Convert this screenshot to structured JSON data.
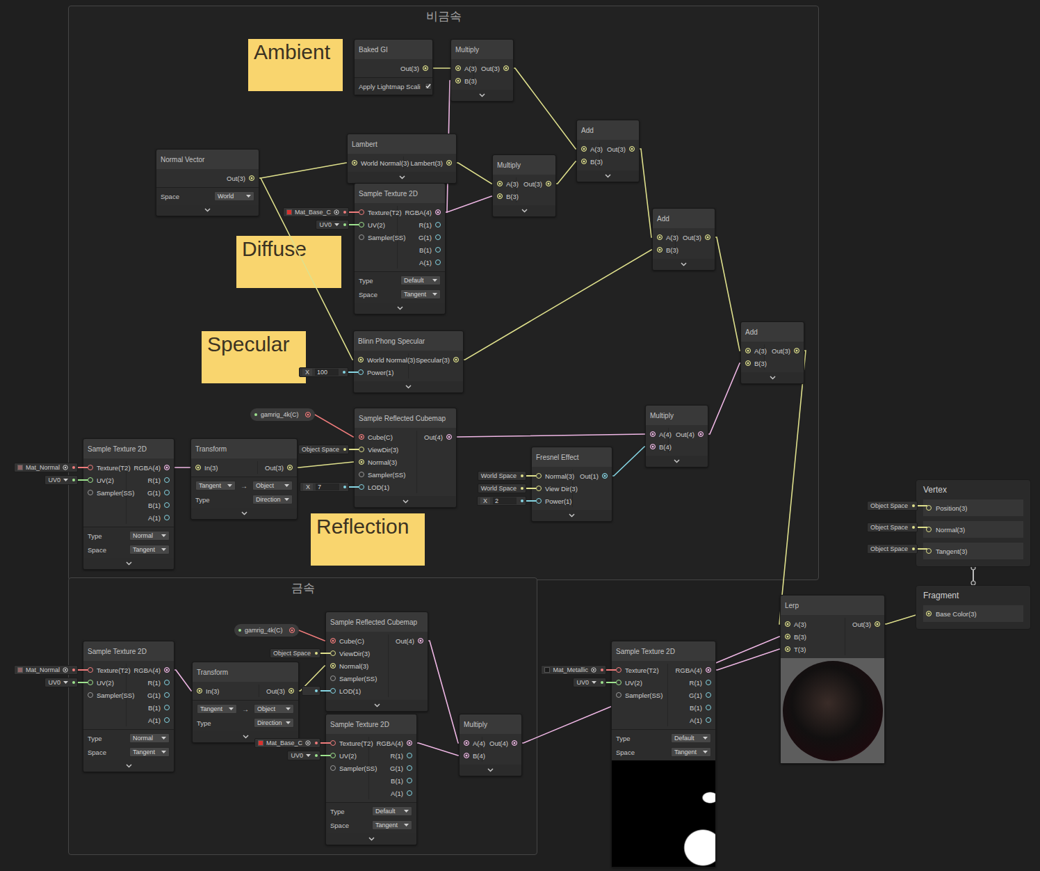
{
  "groups": [
    {
      "title": "비금속"
    },
    {
      "title": "금속"
    }
  ],
  "notes": [
    {
      "text": "Ambient"
    },
    {
      "text": "Diffuse"
    },
    {
      "text": "Specular"
    },
    {
      "text": "Reflection"
    }
  ],
  "pills": [
    {
      "text": "gamrig_4k(C)"
    },
    {
      "text": "gamrig_4k(C)"
    }
  ],
  "nodes": [
    {
      "title": "Baked GI",
      "inputs": [],
      "outputs": [
        {
          "label": "Out(3)",
          "connected": true
        }
      ],
      "props": [
        {
          "kind": "checkbox",
          "label": "Apply Lightmap Scali",
          "checked": true
        }
      ],
      "chevron": false
    },
    {
      "title": "Multiply",
      "inputs": [
        {
          "label": "A(3)",
          "connected": true
        },
        {
          "label": "B(3)",
          "connected": true
        }
      ],
      "outputs": [
        {
          "label": "Out(3)",
          "connected": true
        }
      ],
      "props": [],
      "chevron": true
    },
    {
      "title": "Add",
      "inputs": [
        {
          "label": "A(3)",
          "connected": true
        },
        {
          "label": "B(3)",
          "connected": true
        }
      ],
      "outputs": [
        {
          "label": "Out(3)",
          "connected": true
        }
      ],
      "props": [],
      "chevron": true
    },
    {
      "title": "Normal Vector",
      "inputs": [],
      "outputs": [
        {
          "label": "Out(3)",
          "connected": true
        }
      ],
      "props": [
        {
          "kind": "dropdown",
          "label": "Space",
          "value": "World"
        }
      ],
      "chevron": true
    },
    {
      "title": "Lambert",
      "inputs": [
        {
          "label": "World Normal(3)",
          "connected": true
        }
      ],
      "outputs": [
        {
          "label": "Lambert(3)",
          "connected": true
        }
      ],
      "props": [],
      "chevron": true
    },
    {
      "title": "Multiply",
      "inputs": [
        {
          "label": "A(3)",
          "connected": true
        },
        {
          "label": "B(3)",
          "connected": true
        }
      ],
      "outputs": [
        {
          "label": "Out(3)",
          "connected": true
        }
      ],
      "props": [],
      "chevron": true
    },
    {
      "title": "Sample Texture 2D",
      "inputs": [
        {
          "label": "Texture(T2)",
          "connected": false,
          "field": {
            "kind": "texture",
            "text": "Mat_Base_C",
            "color": "#d8322e"
          }
        },
        {
          "label": "UV(2)",
          "connected": false,
          "field": {
            "kind": "dropdown",
            "text": "UV0"
          }
        },
        {
          "label": "Sampler(SS)",
          "connected": false
        }
      ],
      "outputs": [
        {
          "label": "RGBA(4)",
          "connected": true
        },
        {
          "label": "R(1)",
          "connected": false
        },
        {
          "label": "G(1)",
          "connected": false
        },
        {
          "label": "B(1)",
          "connected": false
        },
        {
          "label": "A(1)",
          "connected": false
        }
      ],
      "props": [
        {
          "kind": "dropdown",
          "label": "Type",
          "value": "Default"
        },
        {
          "kind": "dropdown",
          "label": "Space",
          "value": "Tangent"
        }
      ],
      "chevron": true
    },
    {
      "title": "Add",
      "inputs": [
        {
          "label": "A(3)",
          "connected": true
        },
        {
          "label": "B(3)",
          "connected": true
        }
      ],
      "outputs": [
        {
          "label": "Out(3)",
          "connected": true
        }
      ],
      "props": [],
      "chevron": true
    },
    {
      "title": "Add",
      "inputs": [
        {
          "label": "A(3)",
          "connected": true
        },
        {
          "label": "B(3)",
          "connected": true
        }
      ],
      "outputs": [
        {
          "label": "Out(3)",
          "connected": true
        }
      ],
      "props": [],
      "chevron": true
    },
    {
      "title": "Blinn Phong Specular",
      "inputs": [
        {
          "label": "World Normal(3)",
          "connected": true
        },
        {
          "label": "Power(1)",
          "connected": false,
          "field": {
            "kind": "number",
            "label": "X",
            "text": "100"
          }
        }
      ],
      "outputs": [
        {
          "label": "Specular(3)",
          "connected": true
        }
      ],
      "props": [],
      "chevron": true
    },
    {
      "title": "Sample Reflected Cubemap",
      "inputs": [
        {
          "label": "Cube(C)",
          "connected": true
        },
        {
          "label": "ViewDir(3)",
          "connected": false,
          "field": {
            "kind": "text",
            "text": "Object Space"
          }
        },
        {
          "label": "Normal(3)",
          "connected": true
        },
        {
          "label": "Sampler(SS)",
          "connected": false
        },
        {
          "label": "LOD(1)",
          "connected": false,
          "field": {
            "kind": "number",
            "label": "X",
            "text": "7"
          }
        }
      ],
      "outputs": [
        {
          "label": "Out(4)",
          "connected": true
        }
      ],
      "props": [],
      "chevron": true
    },
    {
      "title": "Multiply",
      "inputs": [
        {
          "label": "A(4)",
          "connected": true
        },
        {
          "label": "B(4)",
          "connected": true
        }
      ],
      "outputs": [
        {
          "label": "Out(4)",
          "connected": true
        }
      ],
      "props": [],
      "chevron": true
    },
    {
      "title": "Fresnel Effect",
      "inputs": [
        {
          "label": "Normal(3)",
          "connected": false,
          "field": {
            "kind": "text",
            "text": "World Space"
          }
        },
        {
          "label": "View Dir(3)",
          "connected": false,
          "field": {
            "kind": "text",
            "text": "World Space"
          }
        },
        {
          "label": "Power(1)",
          "connected": false,
          "field": {
            "kind": "number",
            "label": "X",
            "text": "2"
          }
        }
      ],
      "outputs": [
        {
          "label": "Out(1)",
          "connected": true
        }
      ],
      "props": [],
      "chevron": true
    },
    {
      "title": "Sample Texture 2D",
      "inputs": [
        {
          "label": "Texture(T2)",
          "connected": false,
          "field": {
            "kind": "texture",
            "text": "Mat_Normal",
            "color": "#8c6464"
          }
        },
        {
          "label": "UV(2)",
          "connected": false,
          "field": {
            "kind": "dropdown",
            "text": "UV0"
          }
        },
        {
          "label": "Sampler(SS)",
          "connected": false
        }
      ],
      "outputs": [
        {
          "label": "RGBA(4)",
          "connected": true
        },
        {
          "label": "R(1)",
          "connected": false
        },
        {
          "label": "G(1)",
          "connected": false
        },
        {
          "label": "B(1)",
          "connected": false
        },
        {
          "label": "A(1)",
          "connected": false
        }
      ],
      "props": [
        {
          "kind": "dropdown",
          "label": "Type",
          "value": "Normal"
        },
        {
          "kind": "dropdown",
          "label": "Space",
          "value": "Tangent"
        }
      ],
      "chevron": true
    },
    {
      "title": "Transform",
      "inputs": [
        {
          "label": "In(3)",
          "connected": true
        }
      ],
      "outputs": [
        {
          "label": "Out(3)",
          "connected": true
        }
      ],
      "props": [
        {
          "kind": "transform",
          "from": "Tangent",
          "arrow": "→",
          "to": "Object"
        },
        {
          "kind": "dropdown",
          "label": "Type",
          "value": "Direction"
        }
      ],
      "chevron": true
    },
    {
      "title": "Lerp",
      "inputs": [
        {
          "label": "A(3)",
          "connected": true
        },
        {
          "label": "B(3)",
          "connected": true
        },
        {
          "label": "T(3)",
          "connected": true
        }
      ],
      "outputs": [
        {
          "label": "Out(3)",
          "connected": true
        }
      ],
      "props": [],
      "preview": "sphere",
      "chevron": false
    },
    {
      "title": "Sample Texture 2D",
      "inputs": [
        {
          "label": "Texture(T2)",
          "connected": false,
          "field": {
            "kind": "texture",
            "text": "Mat_Normal",
            "color": "#8c6464"
          }
        },
        {
          "label": "UV(2)",
          "connected": false,
          "field": {
            "kind": "dropdown",
            "text": "UV0"
          }
        },
        {
          "label": "Sampler(SS)",
          "connected": false
        }
      ],
      "outputs": [
        {
          "label": "RGBA(4)",
          "connected": true
        },
        {
          "label": "R(1)",
          "connected": false
        },
        {
          "label": "G(1)",
          "connected": false
        },
        {
          "label": "B(1)",
          "connected": false
        },
        {
          "label": "A(1)",
          "connected": false
        }
      ],
      "props": [
        {
          "kind": "dropdown",
          "label": "Type",
          "value": "Normal"
        },
        {
          "kind": "dropdown",
          "label": "Space",
          "value": "Tangent"
        }
      ],
      "chevron": true
    },
    {
      "title": "Transform",
      "inputs": [
        {
          "label": "In(3)",
          "connected": true
        }
      ],
      "outputs": [
        {
          "label": "Out(3)",
          "connected": true
        }
      ],
      "props": [
        {
          "kind": "transform",
          "from": "Tangent",
          "arrow": "→",
          "to": "Object"
        },
        {
          "kind": "dropdown",
          "label": "Type",
          "value": "Direction"
        }
      ],
      "chevron": true
    },
    {
      "title": "Sample Reflected Cubemap",
      "inputs": [
        {
          "label": "Cube(C)",
          "connected": true
        },
        {
          "label": "ViewDir(3)",
          "connected": false,
          "field": {
            "kind": "text",
            "text": "Object Space"
          }
        },
        {
          "label": "Normal(3)",
          "connected": true
        },
        {
          "label": "Sampler(SS)",
          "connected": false
        },
        {
          "label": "LOD(1)",
          "connected": false,
          "field": {
            "kind": "blank"
          }
        }
      ],
      "outputs": [
        {
          "label": "Out(4)",
          "connected": true
        }
      ],
      "props": [],
      "chevron": true
    },
    {
      "title": "Sample Texture 2D",
      "inputs": [
        {
          "label": "Texture(T2)",
          "connected": false,
          "field": {
            "kind": "texture",
            "text": "Mat_Base_C",
            "color": "#d8322e"
          }
        },
        {
          "label": "UV(2)",
          "connected": false,
          "field": {
            "kind": "dropdown",
            "text": "UV0"
          }
        },
        {
          "label": "Sampler(SS)",
          "connected": false
        }
      ],
      "outputs": [
        {
          "label": "RGBA(4)",
          "connected": true
        },
        {
          "label": "R(1)",
          "connected": false
        },
        {
          "label": "G(1)",
          "connected": false
        },
        {
          "label": "B(1)",
          "connected": false
        },
        {
          "label": "A(1)",
          "connected": false
        }
      ],
      "props": [
        {
          "kind": "dropdown",
          "label": "Type",
          "value": "Default"
        },
        {
          "kind": "dropdown",
          "label": "Space",
          "value": "Tangent"
        }
      ],
      "chevron": true
    },
    {
      "title": "Multiply",
      "inputs": [
        {
          "label": "A(4)",
          "connected": true
        },
        {
          "label": "B(4)",
          "connected": true
        }
      ],
      "outputs": [
        {
          "label": "Out(4)",
          "connected": true
        }
      ],
      "props": [],
      "chevron": true
    },
    {
      "title": "Sample Texture 2D",
      "inputs": [
        {
          "label": "Texture(T2)",
          "connected": false,
          "field": {
            "kind": "texture",
            "text": "Mat_Metallic",
            "color": "#1a1a1a"
          }
        },
        {
          "label": "UV(2)",
          "connected": false,
          "field": {
            "kind": "dropdown",
            "text": "UV0"
          }
        },
        {
          "label": "Sampler(SS)",
          "connected": false
        }
      ],
      "outputs": [
        {
          "label": "RGBA(4)",
          "connected": true
        },
        {
          "label": "R(1)",
          "connected": false
        },
        {
          "label": "G(1)",
          "connected": false
        },
        {
          "label": "B(1)",
          "connected": false
        },
        {
          "label": "A(1)",
          "connected": false
        }
      ],
      "props": [
        {
          "kind": "dropdown",
          "label": "Type",
          "value": "Default"
        },
        {
          "kind": "dropdown",
          "label": "Space",
          "value": "Tangent"
        }
      ],
      "preview": "mask",
      "chevron": false
    }
  ],
  "master": {
    "vertex": {
      "title": "Vertex",
      "ports": [
        {
          "label": "Position(3)",
          "connected": false,
          "field": {
            "kind": "text",
            "text": "Object Space"
          }
        },
        {
          "label": "Normal(3)",
          "connected": false,
          "field": {
            "kind": "text",
            "text": "Object Space"
          }
        },
        {
          "label": "Tangent(3)",
          "connected": false,
          "field": {
            "kind": "text",
            "text": "Object Space"
          }
        }
      ]
    },
    "fragment": {
      "title": "Fragment",
      "ports": [
        {
          "label": "Base Color(3)",
          "connected": true
        }
      ]
    }
  }
}
